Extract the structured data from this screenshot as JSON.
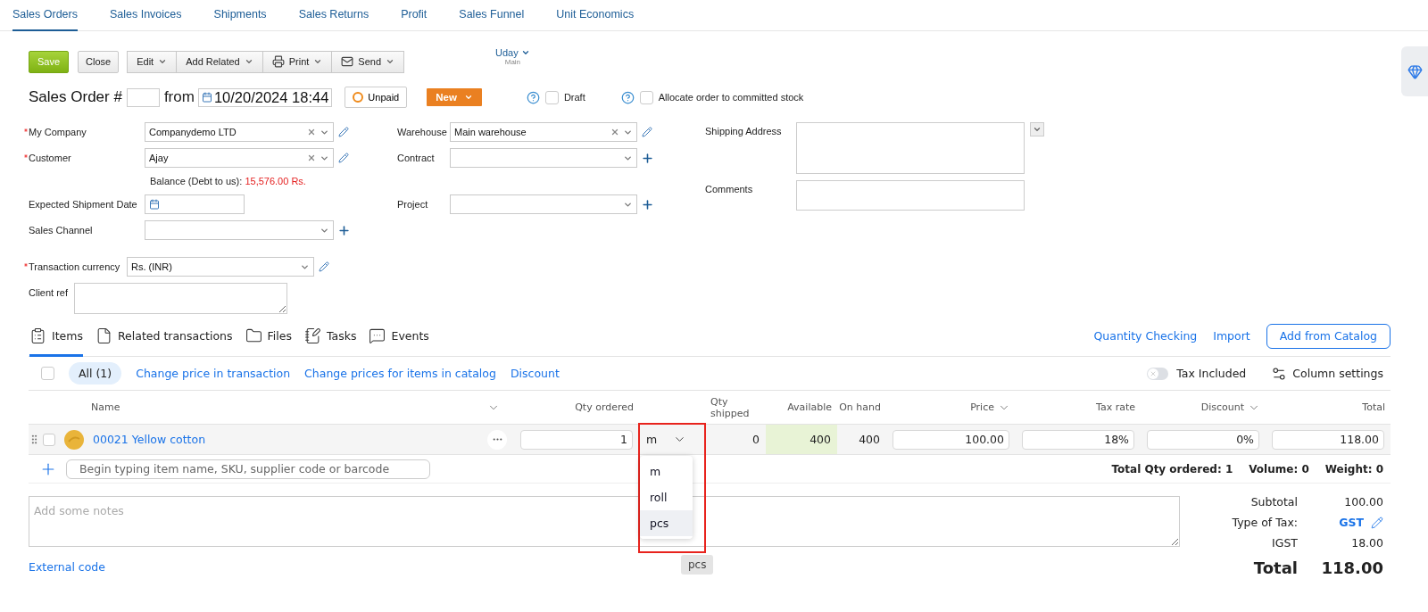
{
  "nav_tabs": [
    {
      "label": "Sales Orders",
      "selected": true
    },
    {
      "label": "Sales Invoices",
      "selected": false
    },
    {
      "label": "Shipments",
      "selected": false
    },
    {
      "label": "Sales Returns",
      "selected": false
    },
    {
      "label": "Profit",
      "selected": false
    },
    {
      "label": "Sales Funnel",
      "selected": false
    },
    {
      "label": "Unit Economics",
      "selected": false
    }
  ],
  "toolbar": {
    "save": "Save",
    "close": "Close",
    "menus": [
      {
        "label": "Edit"
      },
      {
        "label": "Add Related"
      },
      {
        "label": "Print"
      },
      {
        "label": "Send"
      }
    ]
  },
  "user": {
    "name": "Uday",
    "subtitle": "Main"
  },
  "order": {
    "title": "Sales Order #",
    "from": "from",
    "date": "10/20/2024 18:44",
    "payment_status": "Unpaid",
    "status": "New",
    "draft": {
      "label": "Draft",
      "checked": false
    },
    "allocate": {
      "label": "Allocate order to committed stock",
      "checked": false
    }
  },
  "form_left": [
    {
      "label": "My Company",
      "required": true,
      "kind": "select",
      "value": "Companydemo LTD"
    },
    {
      "label": "Customer",
      "required": true,
      "kind": "select",
      "value": "Ajay"
    },
    {
      "label": "Balance (Debt to us):",
      "kind": "balance",
      "value": "15,576.00 Rs."
    },
    {
      "label": "Expected Shipment Date",
      "required": false,
      "kind": "date"
    },
    {
      "label": "Sales Channel",
      "required": false,
      "kind": "select"
    }
  ],
  "form_middle": [
    {
      "label": "Warehouse",
      "required": false,
      "kind": "select",
      "value": "Main warehouse"
    },
    {
      "label": "Contract",
      "required": false,
      "kind": "select"
    },
    {
      "label": "Project",
      "required": false,
      "kind": "select"
    }
  ],
  "form_right": [
    {
      "label": "Shipping Address",
      "kind": "address"
    },
    {
      "label": "Comments",
      "kind": "comments"
    }
  ],
  "currency": {
    "label": "Transaction currency",
    "required": true,
    "value": "Rs. (INR)"
  },
  "client_ref": {
    "label": "Client ref"
  },
  "item_tabs": [
    {
      "label": "Items",
      "selected": true
    },
    {
      "label": "Related transactions",
      "selected": false
    },
    {
      "label": "Files",
      "selected": false
    },
    {
      "label": "Tasks",
      "selected": false
    },
    {
      "label": "Events",
      "selected": false
    }
  ],
  "item_actions": {
    "links": [
      "Quantity Checking",
      "Import"
    ],
    "button": "Add from Catalog"
  },
  "filter_bar": {
    "all_checked": false,
    "chip": "All (1)",
    "links": [
      "Change price in transaction",
      "Change prices for items in catalog",
      "Discount"
    ],
    "tax_included": {
      "label": "Tax Included",
      "on": false
    },
    "column_settings": "Column settings"
  },
  "table": {
    "columns": [
      {
        "label": "Name",
        "has_menu": false
      },
      {
        "has_menu": true
      },
      {
        "label": "Qty ordered",
        "has_menu": false
      },
      {
        "label": "Qty shipped",
        "has_menu": false
      },
      {
        "label": "Available",
        "has_menu": false
      },
      {
        "label": "On hand",
        "has_menu": false
      },
      {
        "label": "Price",
        "has_menu": true
      },
      {
        "label": "Tax rate",
        "has_menu": false
      },
      {
        "label": "Discount",
        "has_menu": true
      },
      {
        "label": "Total",
        "has_menu": false
      }
    ],
    "rows": [
      {
        "checked": false,
        "name": "00021 Yellow cotton",
        "qty_ordered": "1",
        "unit": "m",
        "qty_shipped": "0",
        "available": "400",
        "on_hand": "400",
        "price": "100.00",
        "tax_rate": "18%",
        "discount": "0%",
        "total": "118.00"
      }
    ]
  },
  "unit_dropdown": {
    "outlined": true,
    "options": [
      {
        "label": "m",
        "highlighted": false
      },
      {
        "label": "roll",
        "highlighted": false
      },
      {
        "label": "pcs",
        "highlighted": true
      }
    ],
    "tooltip": "pcs"
  },
  "add_item": {
    "placeholder": "Begin typing item name, SKU, supplier code or barcode"
  },
  "summary": [
    "Total Qty ordered: 1",
    "Volume: 0",
    "Weight: 0"
  ],
  "notes": {
    "placeholder": "Add some notes"
  },
  "totals": [
    {
      "label": "Subtotal",
      "value": "100.00",
      "kind": "plain"
    },
    {
      "label": "Type of Tax:",
      "value": "GST",
      "kind": "link"
    },
    {
      "label": "IGST",
      "value": "18.00",
      "kind": "plain"
    }
  ],
  "grand_total": {
    "label": "Total",
    "value": "118.00"
  },
  "external_code": "External code"
}
